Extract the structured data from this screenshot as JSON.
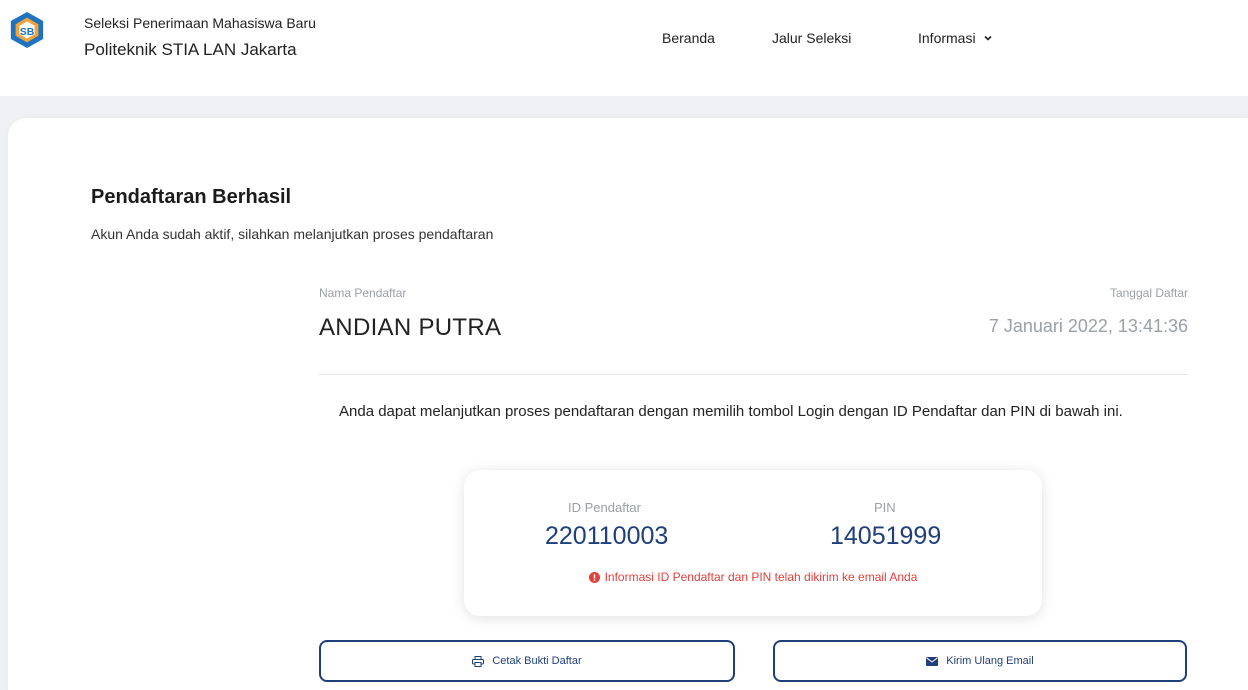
{
  "header": {
    "brand_sub": "Seleksi Penerimaan Mahasiswa Baru",
    "brand_title": "Politeknik STIA LAN Jakarta",
    "logo_icon": "stia-lan-logo-icon",
    "nav": [
      {
        "label": "Beranda"
      },
      {
        "label": "Jalur Seleksi"
      },
      {
        "label": "Informasi"
      }
    ]
  },
  "main": {
    "title": "Pendaftaran Berhasil",
    "subtitle": "Akun Anda sudah aktif, silahkan melanjutkan proses pendaftaran",
    "nama_label": "Nama Pendaftar",
    "nama_value": "ANDIAN PUTRA",
    "tanggal_label": "Tanggal Daftar",
    "tanggal_value": "7 Januari 2022, 13:41:36",
    "instruction": "Anda dapat melanjutkan proses pendaftaran dengan memilih tombol Login dengan ID Pendaftar dan PIN di bawah ini.",
    "credentials": {
      "id_label": "ID Pendaftar",
      "id_value": "220110003",
      "pin_label": "PIN",
      "pin_value": "14051999",
      "notice": "Informasi ID Pendaftar dan PIN telah dikirim ke email Anda",
      "notice_icon": "exclamation-circle-icon"
    },
    "buttons": {
      "cetak": "Cetak Bukti Daftar",
      "cetak_icon": "printer-icon",
      "kirim": "Kirim Ulang Email",
      "kirim_icon": "envelope-icon"
    }
  },
  "colors": {
    "primary": "#1f3f7a",
    "error": "#e2403d",
    "muted": "#9aa0a6",
    "band": "#eef0f3",
    "logo_blue": "#1e73be",
    "logo_orange": "#f2a33a"
  }
}
